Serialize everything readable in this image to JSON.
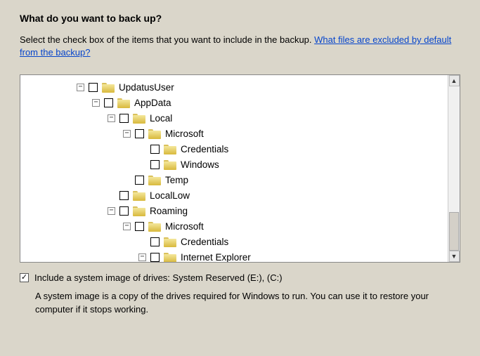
{
  "heading": "What do you want to back up?",
  "instruction_prefix": "Select the check box of the items that you want to include in the backup. ",
  "instruction_link": "What files are excluded by default from the backup?",
  "tree": [
    {
      "indent": 0,
      "expander": "-",
      "checked": false,
      "label": "UpdatusUser"
    },
    {
      "indent": 1,
      "expander": "-",
      "checked": false,
      "label": "AppData"
    },
    {
      "indent": 2,
      "expander": "-",
      "checked": false,
      "label": "Local"
    },
    {
      "indent": 3,
      "expander": "-",
      "checked": false,
      "label": "Microsoft"
    },
    {
      "indent": 4,
      "expander": "",
      "checked": false,
      "label": "Credentials"
    },
    {
      "indent": 4,
      "expander": "",
      "checked": false,
      "label": "Windows"
    },
    {
      "indent": 3,
      "expander": "",
      "checked": false,
      "label": "Temp"
    },
    {
      "indent": 2,
      "expander": "",
      "checked": false,
      "label": "LocalLow"
    },
    {
      "indent": 2,
      "expander": "-",
      "checked": false,
      "label": "Roaming"
    },
    {
      "indent": 3,
      "expander": "-",
      "checked": false,
      "label": "Microsoft"
    },
    {
      "indent": 4,
      "expander": "",
      "checked": false,
      "label": "Credentials"
    },
    {
      "indent": 4,
      "expander": "-",
      "checked": false,
      "label": "Internet Explorer"
    }
  ],
  "system_image_checked": true,
  "system_image_label": "Include a system image of drives: System Reserved (E:), (C:)",
  "system_image_desc": "A system image is a copy of the drives required for Windows to run. You can use it to restore your computer if it stops working."
}
